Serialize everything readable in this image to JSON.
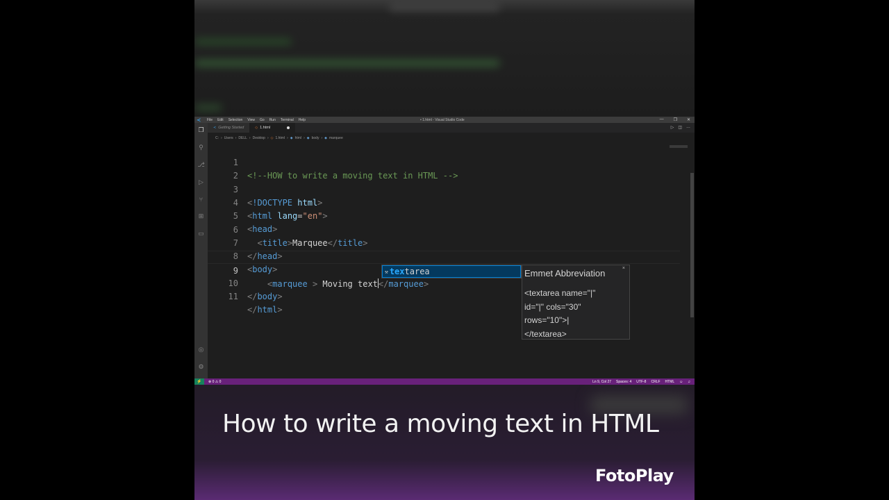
{
  "window": {
    "title": "• 1.html - Visual Studio Code",
    "menu": [
      "File",
      "Edit",
      "Selection",
      "View",
      "Go",
      "Run",
      "Terminal",
      "Help"
    ]
  },
  "tabs": [
    {
      "label": "Getting Started",
      "active": false
    },
    {
      "label": "1.html",
      "active": true,
      "dirty": true
    }
  ],
  "breadcrumb": [
    "C:",
    "Users",
    "DELL",
    "Desktop",
    "1.html",
    "html",
    "body",
    "marquee"
  ],
  "activity_icons": [
    "explorer-icon",
    "search-icon",
    "source-control-icon",
    "run-debug-icon",
    "remote-explorer-icon",
    "extensions-icon",
    "remote-icon",
    "account-icon",
    "settings-gear-icon"
  ],
  "editor": {
    "line_numbers": [
      "1",
      "2",
      "3",
      "4",
      "5",
      "6",
      "7",
      "8",
      "9",
      "10",
      "11"
    ],
    "current_line": 9
  },
  "suggest": {
    "match": "tex",
    "rest": "tarea",
    "details_title": "Emmet Abbreviation",
    "details_body": "<textarea name=\"|\"\nid=\"|\" cols=\"30\"\nrows=\"10\">|\n</textarea>"
  },
  "statusbar": {
    "problems": "⊗ 0 ⚠ 0",
    "position": "Ln 9, Col 27",
    "spaces": "Spaces: 4",
    "encoding": "UTF-8",
    "eol": "CRLF",
    "language": "HTML"
  },
  "overlay": {
    "caption": "How to write a moving text in HTML",
    "watermark": "FotoPlay"
  },
  "colors": {
    "statusbar": "#68217a",
    "selection": "#04395e",
    "accent": "#007fd4"
  }
}
